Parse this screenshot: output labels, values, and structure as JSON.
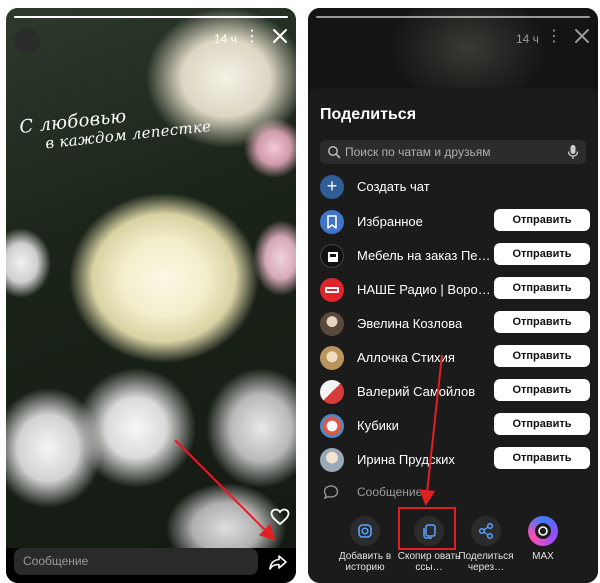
{
  "left": {
    "photo_text": [
      "С любовью",
      "в каждом лепестке"
    ],
    "time": "14 ч",
    "progress": 1.0,
    "message_placeholder": "Сообщение"
  },
  "right": {
    "time": "14 ч",
    "sheet_title": "Поделиться",
    "search_placeholder": "Поиск по чатам и друзьям",
    "create_chat": "Создать чат",
    "send_label": "Отправить",
    "contacts": [
      {
        "name": "Избранное",
        "avatar": "bookmark-icon",
        "color": "#3f74c9"
      },
      {
        "name": "Мебель на заказ Пе…",
        "avatar": "furniture-logo",
        "color": "#111111"
      },
      {
        "name": "НАШЕ Радио | Ворон…",
        "avatar": "radio-logo",
        "color": "#e0242b"
      },
      {
        "name": "Эвелина Козлова",
        "avatar": "photo",
        "color": "#7a6a5a"
      },
      {
        "name": "Аллочка Стихия",
        "avatar": "photo",
        "color": "#c9a876"
      },
      {
        "name": "Валерий Самойлов",
        "avatar": "photo",
        "color": "#c8c8c8"
      },
      {
        "name": "Кубики",
        "avatar": "photo",
        "color": "#d85a4a"
      },
      {
        "name": "Ирина Прудских",
        "avatar": "photo",
        "color": "#b9a08a"
      }
    ],
    "message_label": "Сообщение",
    "actions": [
      {
        "label": "Добавить в историю",
        "icon": "instagram-icon"
      },
      {
        "label": "Скопир овать ссы…",
        "icon": "copy-icon"
      },
      {
        "label": "Поделиться через…",
        "icon": "share-icon"
      },
      {
        "label": "MAX",
        "icon": "max-logo"
      }
    ]
  },
  "colors": {
    "accent_blue": "#2f5e97",
    "annotation_red": "#e02020",
    "sheet_bg": "#1b1b1b"
  }
}
